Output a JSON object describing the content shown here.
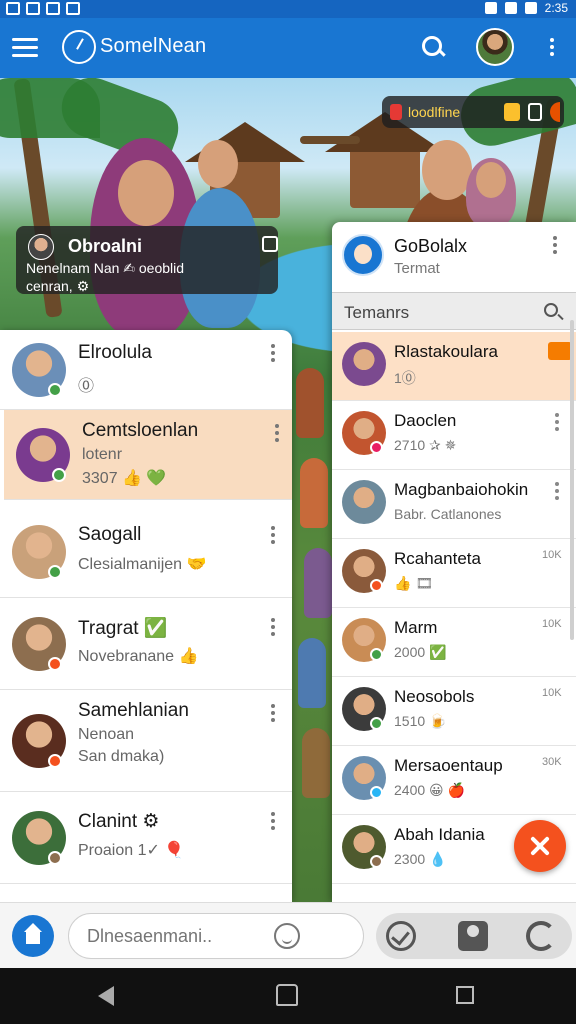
{
  "status_bar": {
    "clock": "2:35"
  },
  "app": {
    "title": "SomelNean"
  },
  "hero": {
    "badge_text": "loodlfine",
    "overlay": {
      "title": "Obroalni",
      "line1": "Nenelnam Nan ✍ oeoblid",
      "line2": "cenran, ⚙"
    }
  },
  "left_list": [
    {
      "name": "Elroolula",
      "sub": "⓪",
      "sub2": "",
      "avatar": "#6b8fb8",
      "status": "#43a047",
      "selected": false
    },
    {
      "name": "Cemtsloenlan",
      "sub": "lotenr",
      "sub2": "3307 👍 💚",
      "avatar": "#7a3b8f",
      "status": "#43a047",
      "selected": true
    },
    {
      "name": "Saogall",
      "sub": "Clesialmanijen 🤝",
      "sub2": "",
      "avatar": "#c9a17a",
      "status": "#43a047",
      "selected": false
    },
    {
      "name": "Tragrat ✅",
      "sub": "Novebranane 👍",
      "sub2": "",
      "avatar": "#8d6e4f",
      "status": "#f4511e",
      "selected": false
    },
    {
      "name": "Samehlanian",
      "sub": "Nenoan",
      "sub2": "San dmaka)",
      "avatar": "#5a2d1f",
      "status": "#f4511e",
      "selected": false
    },
    {
      "name": "Clanint ⚙",
      "sub": "Proaion 1✓ 🎈",
      "sub2": "",
      "avatar": "#3c6e3a",
      "status": "#8d6e4f",
      "selected": false
    }
  ],
  "right_panel": {
    "header_title": "GoBolalx",
    "header_sub": "Termat",
    "search_label": "Temanrs",
    "items": [
      {
        "name": "Rlastakoulara",
        "sub": "1⓪",
        "count": "",
        "avatar": "#7b4a8f",
        "status": "",
        "selected": true
      },
      {
        "name": "Daoclen",
        "sub": "2710 ✰ ✵",
        "count": "",
        "avatar": "#c2552f",
        "status": "#e91e63",
        "selected": false
      },
      {
        "name": "Magbanbaiohokin",
        "sub": "Babr. Catlanones",
        "count": "",
        "avatar": "#6d8a9b",
        "status": "",
        "selected": false
      },
      {
        "name": "Rcahanteta",
        "sub": "👍 🎞",
        "count": "10K",
        "avatar": "#8a5a3b",
        "status": "#f4511e",
        "selected": false
      },
      {
        "name": "Marm",
        "sub": "2000 ✅",
        "count": "10K",
        "avatar": "#c98c55",
        "status": "#43a047",
        "selected": false
      },
      {
        "name": "Neosobols",
        "sub": "1510 🍺",
        "count": "10K",
        "avatar": "#3b3b3b",
        "status": "#43a047",
        "selected": false
      },
      {
        "name": "Mersaoentaup",
        "sub": "2400 😀 🍎",
        "count": "30K",
        "avatar": "#6a8fb0",
        "status": "#29b6f6",
        "selected": false
      },
      {
        "name": "Abah Idania",
        "sub": "2300 💧",
        "count": "",
        "avatar": "#4e5a2e",
        "status": "#8d6e4f",
        "selected": false
      }
    ]
  },
  "bottom_bar": {
    "input_placeholder": "Dlnesaenmani.."
  }
}
